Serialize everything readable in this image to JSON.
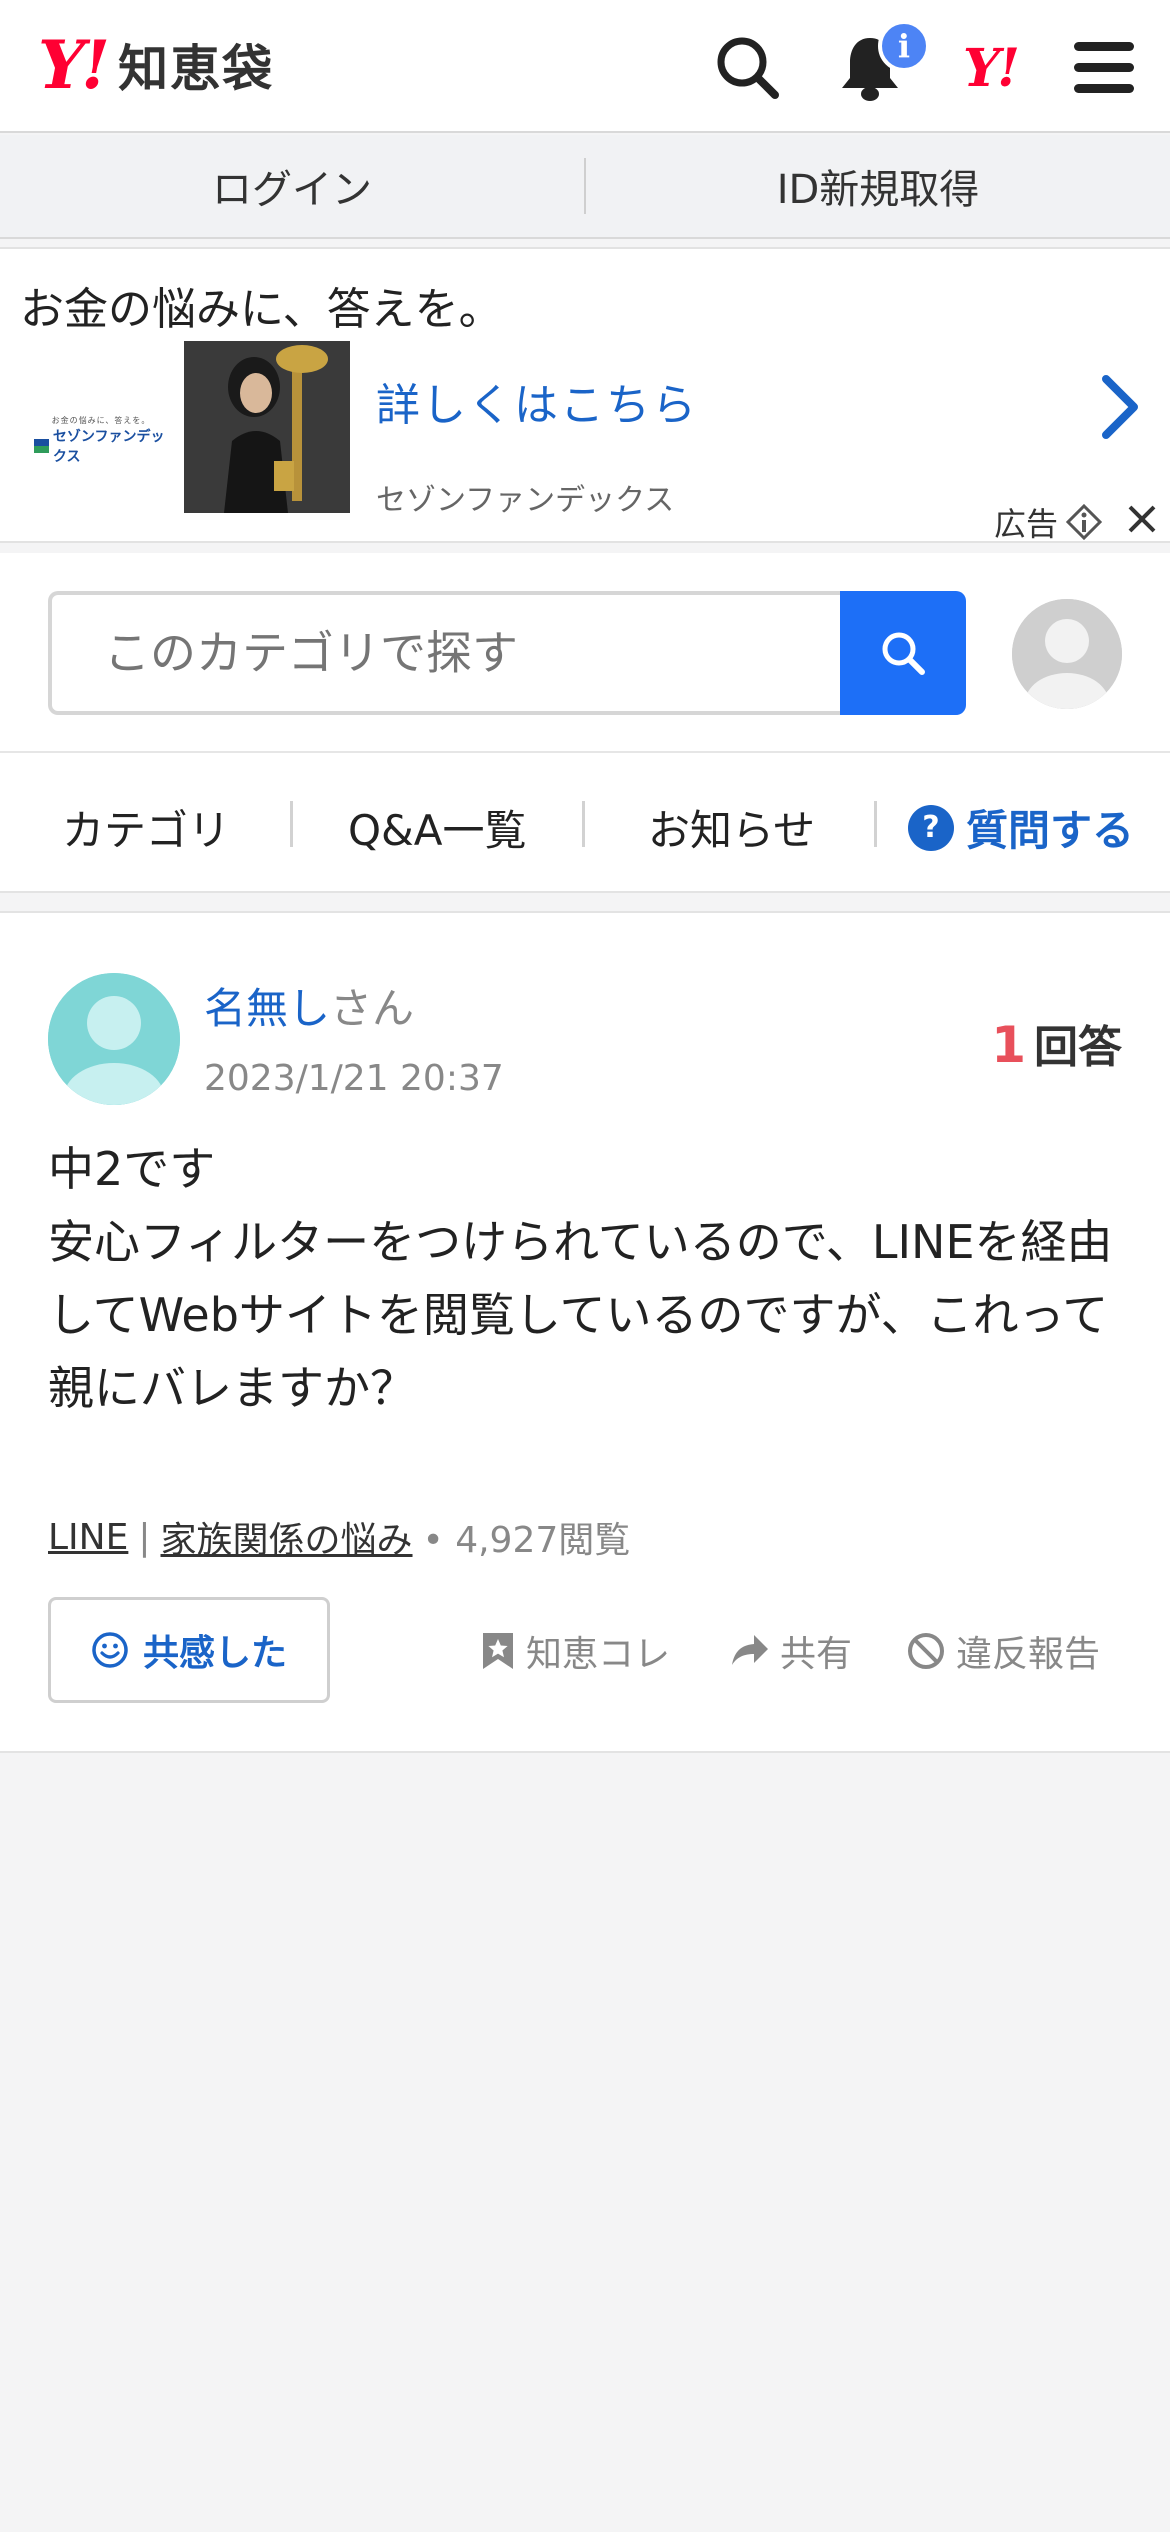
{
  "header": {
    "logo_mark": "Y!",
    "site_name": "知恵袋",
    "notification_badge": "i",
    "yahoo_mark": "Y!"
  },
  "account_bar": {
    "login": "ログイン",
    "register": "ID新規取得"
  },
  "ad": {
    "headline": "お金の悩みに、答えを。",
    "brand_tagline": "お金の悩みに、答えを。",
    "brand_name": "セゾンファンデックス",
    "link_text": "詳しくはこちら",
    "advertiser": "セゾンファンデックス",
    "ad_label": "広告"
  },
  "search": {
    "placeholder": "このカテゴリで探す"
  },
  "tabs": {
    "category": "カテゴリ",
    "qa_list": "Q&A一覧",
    "news": "お知らせ",
    "ask": "質問する"
  },
  "question": {
    "user_name": "名無し",
    "user_suffix": "さん",
    "date": "2023/1/21 20:37",
    "answer_count": "1",
    "answer_label": "回答",
    "body": "中2です\n安心フィルターをつけられているので、LINEを経由してWebサイトを閲覧しているのですが、これって親にバレますか？",
    "tag1": "LINE",
    "tag_sep": "|",
    "tag2": "家族関係の悩み",
    "views": "• 4,927閲覧",
    "empathy": "共感した",
    "bookmark": "知恵コレ",
    "share": "共有",
    "report": "違反報告"
  },
  "colors": {
    "brand_red": "#ff0033",
    "link_blue": "#1a64c8",
    "search_blue": "#1d6ff7",
    "answer_count_red": "#e8505b"
  }
}
